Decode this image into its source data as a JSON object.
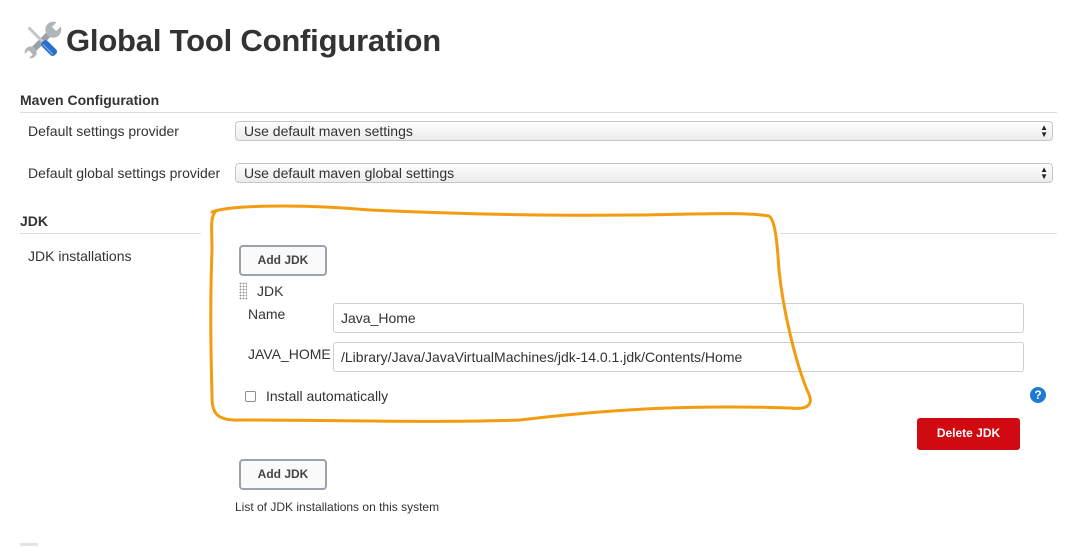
{
  "page": {
    "title": "Global Tool Configuration",
    "icon": "tools-icon"
  },
  "maven": {
    "header": "Maven Configuration",
    "settings_label": "Default settings provider",
    "settings_value": "Use default maven settings",
    "global_settings_label": "Default global settings provider",
    "global_settings_value": "Use default maven global settings"
  },
  "jdk": {
    "header": "JDK",
    "installations_label": "JDK installations",
    "add_button": "Add JDK",
    "entry_title": "JDK",
    "name_label": "Name",
    "name_value": "Java_Home",
    "java_home_label": "JAVA_HOME",
    "java_home_value": "/Library/Java/JavaVirtualMachines/jdk-14.0.1.jdk/Contents/Home",
    "install_automatically_label": "Install automatically",
    "install_automatically_checked": false,
    "help_symbol": "?",
    "delete_button": "Delete JDK",
    "add_button_bottom": "Add JDK",
    "description": "List of JDK installations on this system"
  },
  "annotation": {
    "color": "#f39c12"
  },
  "colors": {
    "delete": "#d10a11",
    "help": "#1f7ad6"
  }
}
